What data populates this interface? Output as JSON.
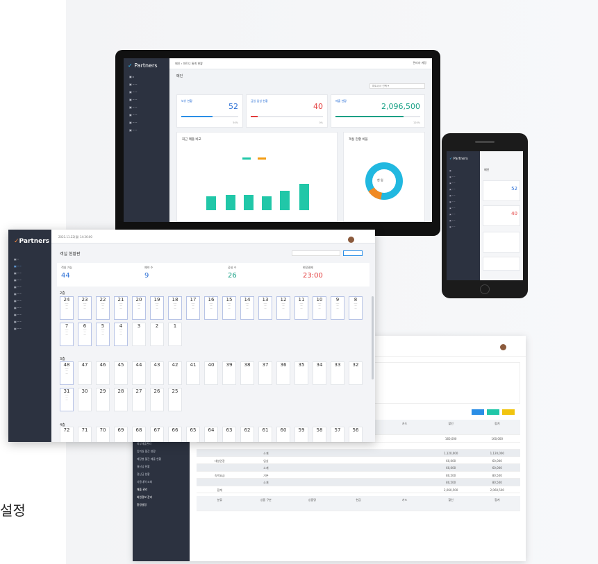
{
  "side_text": "설정",
  "monitor": {
    "brand": "Partners",
    "breadcrumb": "메인 › 파트너 통계 현황",
    "page_title": "메인",
    "user": "관리자 계정",
    "filter": "파트너사 선택 ▾",
    "kpis": [
      {
        "title": "보유 현황",
        "sub": "객실 전체",
        "value": "52",
        "foot": "50%"
      },
      {
        "title": "금일 입실 현황",
        "sub": "입실 예정",
        "value": "40",
        "foot": "0%"
      },
      {
        "title": "매출 현황",
        "sub": "월 누적",
        "value": "2,096,500",
        "foot": "120%"
      }
    ],
    "chart_title": "최근 매출 비교",
    "donut_title": "객실 현황 비율",
    "donut_label": "현 입"
  },
  "phone": {
    "brand": "Partners",
    "title": "메인",
    "val1": "52",
    "val2": "40"
  },
  "room": {
    "brand": "Partners",
    "date": "2021.11.22(월) 14:36:00",
    "page_title": "객실 현황판",
    "stats": [
      {
        "label": "객실 가능",
        "value": "44"
      },
      {
        "label": "예약 수",
        "value": "9"
      },
      {
        "label": "공실 수",
        "value": "26"
      },
      {
        "label": "현장결제",
        "value": "23:00"
      }
    ],
    "floor2": "2층",
    "row1": [
      "24",
      "23",
      "22",
      "21",
      "20",
      "19",
      "18",
      "17",
      "16",
      "15",
      "14",
      "13",
      "12",
      "11",
      "10",
      "9",
      "8"
    ],
    "row2": [
      "7",
      "6",
      "5",
      "4",
      "3",
      "2",
      "1"
    ],
    "floor3": "3층",
    "row3": [
      "48",
      "47",
      "46",
      "45",
      "44",
      "43",
      "42",
      "41",
      "40",
      "39",
      "38",
      "37",
      "36",
      "35",
      "34",
      "33",
      "32"
    ],
    "row4": [
      "31",
      "30",
      "29",
      "28",
      "27",
      "26",
      "25"
    ],
    "floor4": "4층",
    "row5": [
      "72",
      "71",
      "70",
      "69",
      "68",
      "67",
      "66",
      "65",
      "64",
      "63",
      "62",
      "61",
      "60",
      "59",
      "58",
      "57",
      "56"
    ]
  },
  "table": {
    "sidebar": [
      "외부매출관리",
      "입퇴실 월간 현황",
      "매장별 월간 매출 현황",
      "결산금 현황",
      "정산금 현황",
      "사용내역 조회",
      "매출 관리",
      "회원정보 관리",
      "환경설정"
    ],
    "header": [
      "분류",
      "상품 구분",
      "상품명",
      "현금",
      "카드",
      "할인",
      "합계"
    ],
    "rows": [
      [
        "대실요금",
        "입실",
        "160,000",
        "160,000"
      ],
      [
        "",
        "소계",
        "1,120,000",
        "1,120,000"
      ],
      [
        "대실연장",
        "입실",
        "60,000",
        "60,000"
      ],
      [
        "",
        "소계",
        "60,000",
        "60,000"
      ],
      [
        "숙박요금",
        "기본",
        "80,500",
        "80,500"
      ],
      [
        "",
        "소계",
        "80,500",
        "80,500"
      ],
      [
        "합계",
        "",
        "2,060,500",
        "2,060,500"
      ]
    ]
  }
}
